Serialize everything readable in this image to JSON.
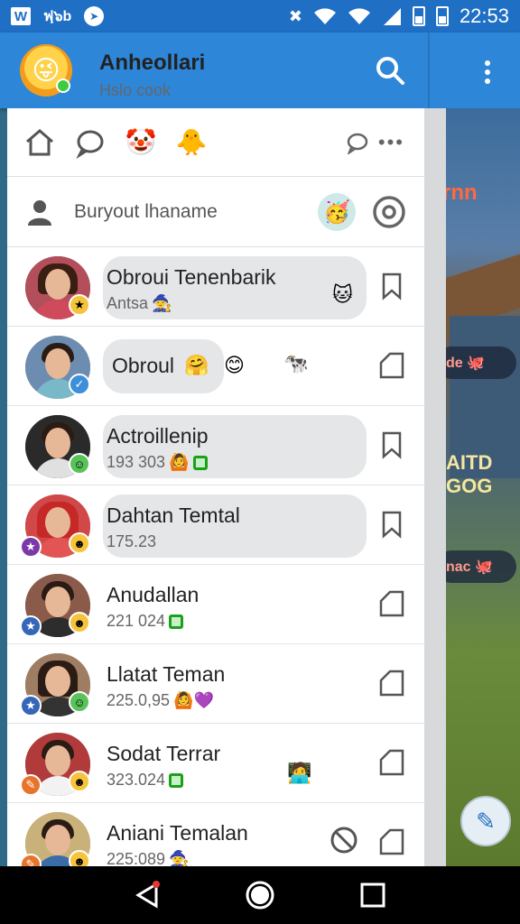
{
  "status_bar": {
    "left_icons": [
      "w-icon",
      "signal-text-icon",
      "telegram-icon"
    ],
    "signal_text": "ฟฺ๖b",
    "w_letter": "W",
    "time": "22:53"
  },
  "app_bar": {
    "title": "Anheollari",
    "subtitle": "Hslo cook"
  },
  "profile": {
    "name": "Buryout lhaname"
  },
  "contacts": [
    {
      "name": "Obroui Tenenbarik",
      "sub": "Antsa",
      "sub_emoji": "🧙",
      "end_emoji": "🐱",
      "style": "bubble",
      "action": "bookmark"
    },
    {
      "name": "Obroul",
      "sub": "",
      "sub_emoji": "",
      "name_emoji": "🤗",
      "extra_emoji_1": "😊",
      "extra_emoji_2": "🐄",
      "style": "small-bubble",
      "action": "share"
    },
    {
      "name": "Actroillenip",
      "sub": "193 303",
      "sub_emoji": "🙆",
      "green_box": true,
      "style": "bubble",
      "action": "bookmark"
    },
    {
      "name": "Dahtan Temtal",
      "sub": "175.23",
      "sub_emoji": "",
      "style": "bubble",
      "action": "bookmark"
    },
    {
      "name": "Anudallan",
      "sub": "221 024",
      "green_box": true,
      "style": "plain",
      "action": "share"
    },
    {
      "name": "Llatat Teman",
      "sub": "225.0,95",
      "sub_emoji": "🙆💜",
      "style": "plain",
      "action": "share"
    },
    {
      "name": "Sodat Terrar",
      "sub": "323.024",
      "green_box": true,
      "end_emoji": "🧑‍💻",
      "style": "plain",
      "action": "share"
    },
    {
      "name": "Aniani Temalan",
      "sub": "225:089",
      "sub_emoji": "🧙",
      "style": "plain",
      "action": "share",
      "block": true
    }
  ],
  "scene": {
    "top_label": "ɾnn",
    "pill_1": "de 🐙",
    "sign_text": "AITD GOG",
    "pill_2": "nac 🐙"
  }
}
